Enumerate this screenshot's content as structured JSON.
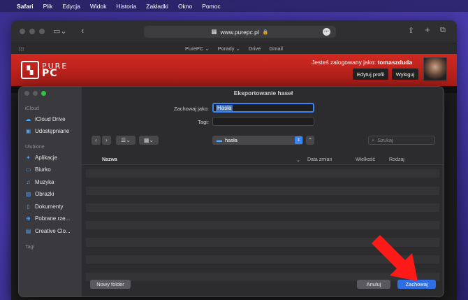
{
  "menubar": {
    "apple": "",
    "items": [
      "Safari",
      "Plik",
      "Edycja",
      "Widok",
      "Historia",
      "Zakładki",
      "Okno",
      "Pomoc"
    ]
  },
  "browser": {
    "url": "www.purepc.pl",
    "favorites": [
      "PurePC ⌄",
      "Porady ⌄",
      "Drive",
      "Gmail"
    ]
  },
  "site": {
    "logo_top": "PURE",
    "logo_bottom": "PC",
    "login_prefix": "Jesteś zalogowany jako:",
    "username": "tomaszduda",
    "edit_profile": "Edytuj profil",
    "logout": "Wyloguj"
  },
  "dialog": {
    "title": "Eksportowanie haseł",
    "save_as_label": "Zachowaj jako:",
    "save_as_value": "Hasła",
    "tags_label": "Tagi:",
    "tags_value": "",
    "folder": "hasła",
    "search_placeholder": "Szukaj",
    "columns": {
      "name": "Nazwa",
      "date": "Data zmian",
      "size": "Wielkość",
      "kind": "Rodzaj"
    },
    "new_folder": "Nowy folder",
    "cancel": "Anuluj",
    "save": "Zachowaj",
    "sidebar": {
      "icloud_header": "iCloud",
      "icloud_items": [
        "iCloud Drive",
        "Udostępniane"
      ],
      "favorites_header": "Ulubione",
      "favorites_items": [
        "Aplikacje",
        "Biurko",
        "Muzyka",
        "Obrazki",
        "Dokumenty",
        "Pobrane rze...",
        "Creative Clo..."
      ],
      "tags_header": "Tagi"
    }
  },
  "colors": {
    "accent": "#2f6fe4",
    "site_red": "#c1231d",
    "arrow_red": "#ff1a1a"
  }
}
